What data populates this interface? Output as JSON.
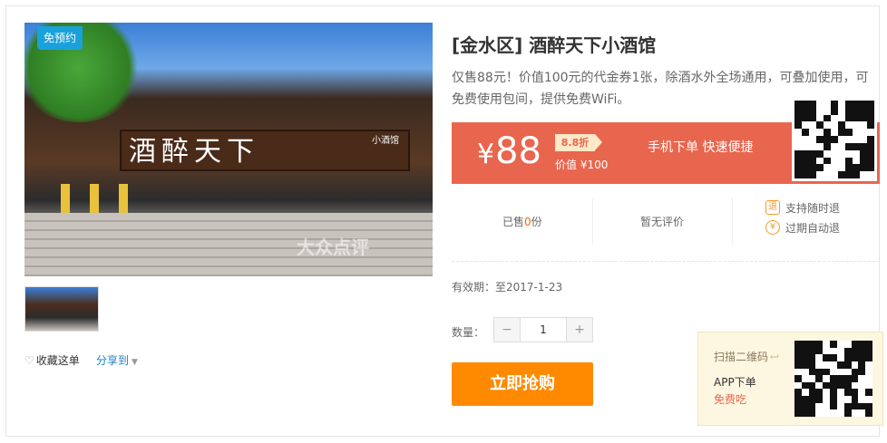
{
  "gallery": {
    "badge": "免预约",
    "sign_text": "酒醉天下",
    "sign_sub": "小酒馆",
    "watermark": "大众点评",
    "favorite_label": "收藏这单",
    "share_label": "分享到"
  },
  "deal": {
    "title": "[金水区] 酒醉天下小酒馆",
    "description": "仅售88元！价值100元的代金券1张，除酒水外全场通用，可叠加使用，可免费使用包间，提供免费WiFi。",
    "price_symbol": "¥",
    "price": "88",
    "discount": "8.8折",
    "original_price": "价值 ¥100",
    "quick_order": "手机下单 快速便捷",
    "sold_prefix": "已售",
    "sold_count": "0",
    "sold_suffix": "份",
    "reviews": "暂无评价",
    "guarantees": [
      "支持随时退",
      "过期自动退"
    ],
    "validity": "有效期：至2017-1-23",
    "quantity_label": "数量：",
    "quantity": "1",
    "minus": "−",
    "plus": "+",
    "buy_label": "立即抢购"
  },
  "app": {
    "scan_label": "扫描二维码",
    "order_label": "APP下单",
    "free_label": "免费吃"
  },
  "colors": {
    "price_bar": "#e9664e",
    "buy_button": "#ff8a00",
    "accent_orange": "#f60",
    "link_blue": "#1a7fc9"
  }
}
